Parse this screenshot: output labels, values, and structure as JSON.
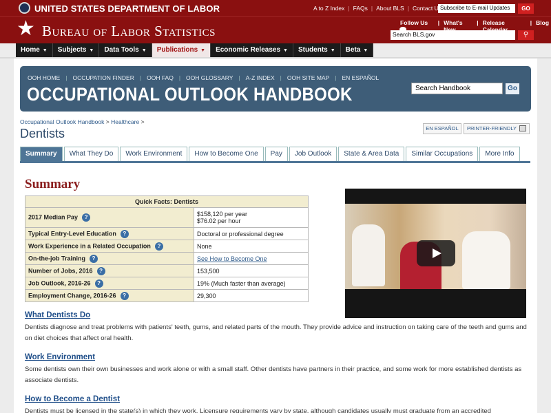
{
  "header": {
    "department_title": "UNITED STATES DEPARTMENT OF LABOR",
    "utility_links": [
      "A to Z Index",
      "FAQs",
      "About BLS",
      "Contact Us"
    ],
    "email_placeholder": "Subscribe to E-mail Updates",
    "go_label": "GO",
    "site_title": "Bureau of Labor Statistics",
    "follow_label": "Follow Us",
    "quick_links": [
      "What's New",
      "Release Calendar",
      "Blog"
    ],
    "search_placeholder": "Search BLS.gov"
  },
  "nav": {
    "items": [
      "Home",
      "Subjects",
      "Data Tools",
      "Publications",
      "Economic Releases",
      "Students",
      "Beta"
    ],
    "active": "Publications"
  },
  "ooh": {
    "links": [
      "OOH HOME",
      "OCCUPATION FINDER",
      "OOH FAQ",
      "OOH GLOSSARY",
      "A-Z INDEX",
      "OOH SITE MAP",
      "EN ESPAÑOL"
    ],
    "title": "OCCUPATIONAL OUTLOOK HANDBOOK",
    "search_placeholder": "Search Handbook",
    "go_label": "Go"
  },
  "breadcrumb": {
    "items": [
      "Occupational Outlook Handbook",
      "Healthcare"
    ],
    "sep": ">"
  },
  "page_title": "Dentists",
  "buttons": {
    "spanish": "EN ESPAÑOL",
    "print": "PRINTER-FRIENDLY"
  },
  "tabs": {
    "items": [
      "Summary",
      "What They Do",
      "Work Environment",
      "How to Become One",
      "Pay",
      "Job Outlook",
      "State & Area Data",
      "Similar Occupations",
      "More Info"
    ],
    "active": "Summary"
  },
  "summary": {
    "heading": "Summary",
    "quick_facts": {
      "title": "Quick Facts: Dentists",
      "rows": [
        {
          "label": "2017 Median Pay",
          "value": "$158,120 per year",
          "value2": "$76.02 per hour"
        },
        {
          "label": "Typical Entry-Level Education",
          "value": "Doctoral or professional degree"
        },
        {
          "label": "Work Experience in a Related Occupation",
          "value": "None"
        },
        {
          "label": "On-the-job Training",
          "value": "See How to Become One"
        },
        {
          "label": "Number of Jobs, 2016",
          "value": "153,500"
        },
        {
          "label": "Job Outlook, 2016-26",
          "value": "19% (Much faster than average)"
        },
        {
          "label": "Employment Change, 2016-26",
          "value": "29,300"
        }
      ]
    }
  },
  "sections": [
    {
      "title": "What Dentists Do",
      "text": "Dentists diagnose and treat problems with patients' teeth, gums, and related parts of the mouth. They provide advice and instruction on taking care of the teeth and gums and on diet choices that affect oral health."
    },
    {
      "title": "Work Environment",
      "text": "Some dentists own their own businesses and work alone or with a small staff. Other dentists have partners in their practice, and some work for more established dentists as associate dentists."
    },
    {
      "title": "How to Become a Dentist",
      "text": "Dentists must be licensed in the state(s) in which they work. Licensure requirements vary by state, although candidates usually must graduate from an accredited"
    }
  ]
}
